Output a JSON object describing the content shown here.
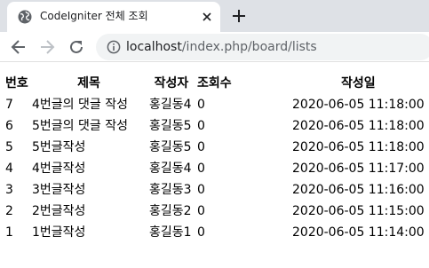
{
  "browser": {
    "tab_title": "CodeIgniter 전체 조회",
    "url_host": "localhost",
    "url_path": "/index.php/board/lists"
  },
  "board": {
    "headers": {
      "no": "번호",
      "title": "제목",
      "author": "작성자",
      "hits": "조회수",
      "date": "작성일"
    },
    "rows": [
      {
        "no": "7",
        "title": "4번글의 댓글 작성",
        "author": "홍길동4",
        "hits": "0",
        "date": "2020-06-05 11:18:00"
      },
      {
        "no": "6",
        "title": "5번글의 댓글 작성",
        "author": "홍길동5",
        "hits": "0",
        "date": "2020-06-05 11:18:00"
      },
      {
        "no": "5",
        "title": "5번글작성",
        "author": "홍길동5",
        "hits": "0",
        "date": "2020-06-05 11:18:00"
      },
      {
        "no": "4",
        "title": "4번글작성",
        "author": "홍길동4",
        "hits": "0",
        "date": "2020-06-05 11:17:00"
      },
      {
        "no": "3",
        "title": "3번글작성",
        "author": "홍길동3",
        "hits": "0",
        "date": "2020-06-05 11:16:00"
      },
      {
        "no": "2",
        "title": "2번글작성",
        "author": "홍길동2",
        "hits": "0",
        "date": "2020-06-05 11:15:00"
      },
      {
        "no": "1",
        "title": "1번글작성",
        "author": "홍길동1",
        "hits": "0",
        "date": "2020-06-05 11:14:00"
      }
    ]
  }
}
